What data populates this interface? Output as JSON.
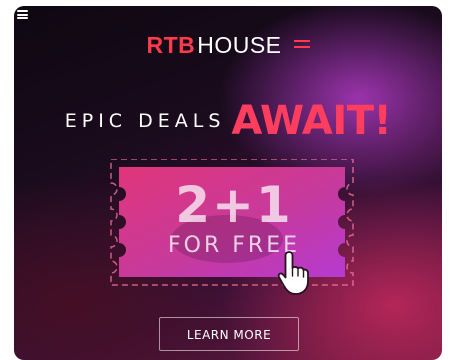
{
  "logo": {
    "rtb": "RTB",
    "house": "HOUSE"
  },
  "headline": {
    "epic": "EPIC DEALS",
    "await": "AWAIT!"
  },
  "ticket": {
    "big": "2+1",
    "small": "FOR FREE"
  },
  "cta": {
    "label": "LEARN MORE"
  },
  "icons": {
    "menu": "menu-icon",
    "hand": "pointing-hand-icon"
  },
  "colors": {
    "brand_red": "#ff3a4c",
    "accent_pink": "#ff3d5f",
    "ticket_gradient_start": "#e0367a",
    "ticket_gradient_end": "#b53ad0"
  }
}
